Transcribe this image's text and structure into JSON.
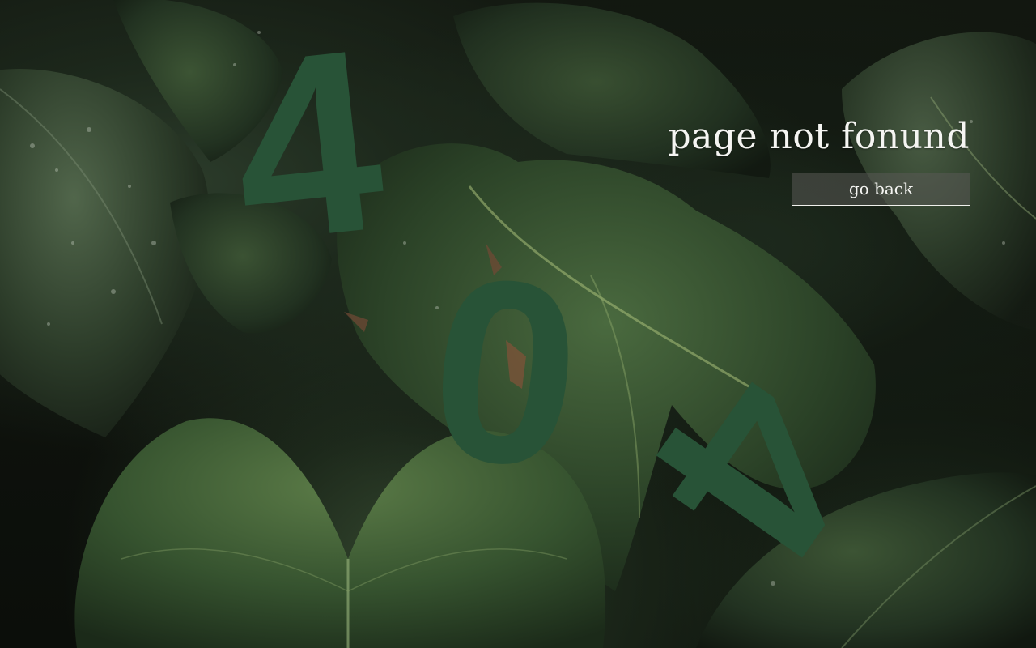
{
  "error": {
    "code_digits": [
      "4",
      "0",
      "4"
    ],
    "message": "page not fonund",
    "back_button_label": "go back"
  },
  "colors": {
    "digit_green": "#285337",
    "text_white": "#f5f5f2",
    "button_border": "#f0f0ec"
  },
  "background": {
    "subject": "dark tropical leaves with water droplets"
  }
}
